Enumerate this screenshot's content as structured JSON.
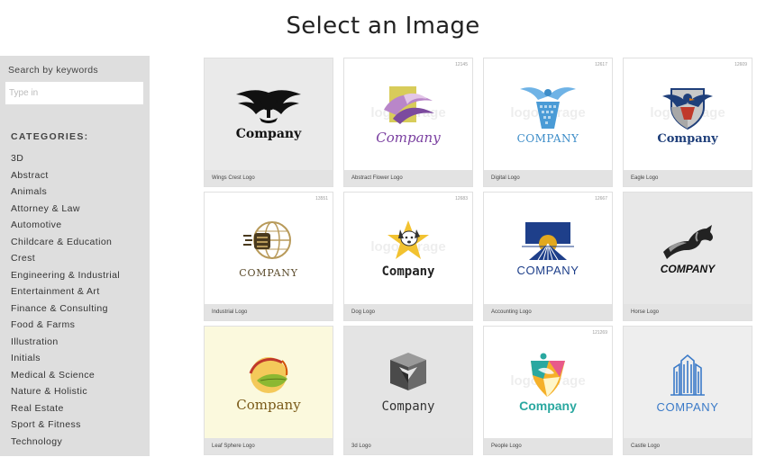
{
  "page": {
    "title": "Select an Image"
  },
  "search": {
    "label": "Search by keywords",
    "placeholder": "Type in",
    "value": ""
  },
  "categories": {
    "title": "CATEGORIES:",
    "items": [
      "3D",
      "Abstract",
      "Animals",
      "Attorney & Law",
      "Automotive",
      "Childcare & Education",
      "Crest",
      "Engineering & Industrial",
      "Entertainment & Art",
      "Finance & Consulting",
      "Food & Farms",
      "Illustration",
      "Initials",
      "Medical & Science",
      "Nature & Holistic",
      "Real Estate",
      "Sport & Fitness",
      "Technology"
    ]
  },
  "watermark": "logoGarage",
  "logos": [
    {
      "name": "Wings Crest Logo",
      "id": "",
      "brand": "Company",
      "icon": "wings-crest-icon",
      "bg": "#eaeaea",
      "brand_color": "#111111"
    },
    {
      "name": "Abstract Flower Logo",
      "id": "12145",
      "brand": "Company",
      "icon": "abstract-flower-icon",
      "bg": "#ffffff",
      "brand_color": "#7a3fa0"
    },
    {
      "name": "Digital Logo",
      "id": "12617",
      "brand": "COMPANY",
      "icon": "digital-eagle-icon",
      "bg": "#ffffff",
      "brand_color": "#3d8dc8"
    },
    {
      "name": "Eagle Logo",
      "id": "12609",
      "brand": "Company",
      "icon": "eagle-shield-icon",
      "bg": "#ffffff",
      "brand_color": "#1f3f7a"
    },
    {
      "name": "Industrial Logo",
      "id": "13551",
      "brand": "COMPANY",
      "icon": "industrial-globe-icon",
      "bg": "#ffffff",
      "brand_color": "#5a4a2a"
    },
    {
      "name": "Dog Logo",
      "id": "12683",
      "brand": "Company",
      "icon": "dog-star-icon",
      "bg": "#ffffff",
      "brand_color": "#222222"
    },
    {
      "name": "Accounting Logo",
      "id": "12667",
      "brand": "COMPANY",
      "icon": "accounting-sunrise-icon",
      "bg": "#ffffff",
      "brand_color": "#1e3f8a"
    },
    {
      "name": "Horse Logo",
      "id": "",
      "brand": "COMPANY",
      "icon": "horse-icon",
      "bg": "#e8e8e8",
      "brand_color": "#111111"
    },
    {
      "name": "Leaf Sphere Logo",
      "id": "",
      "brand": "Company",
      "icon": "leaf-sphere-icon",
      "bg": "#fbf9dd",
      "brand_color": "#7a5a18"
    },
    {
      "name": "3d Logo",
      "id": "",
      "brand": "Company",
      "icon": "3d-cube-icon",
      "bg": "#e4e4e4",
      "brand_color": "#333333"
    },
    {
      "name": "People Logo",
      "id": "121269",
      "brand": "Company",
      "icon": "people-shield-icon",
      "bg": "#ffffff",
      "brand_color": "#2aa8a0"
    },
    {
      "name": "Castle Logo",
      "id": "",
      "brand": "COMPANY",
      "icon": "castle-building-icon",
      "bg": "#eeeeee",
      "brand_color": "#3a7ac8"
    }
  ]
}
